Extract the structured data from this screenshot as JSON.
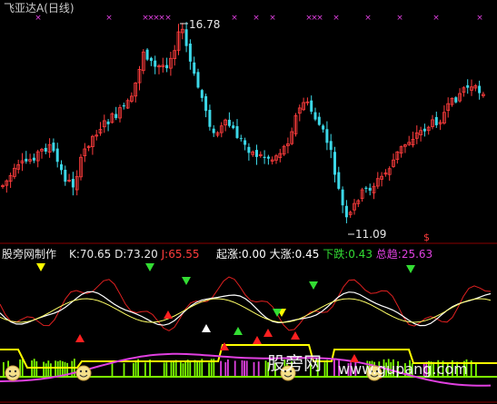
{
  "header": {
    "title": "飞亚达A",
    "period": "(日线)",
    "title_color": "#dddddd"
  },
  "price_panel": {
    "type": "candlestick",
    "high_label": "16.78",
    "low_label": "11.09",
    "high": 16.78,
    "low": 11.09,
    "dollar_mark": "$",
    "x_markers": "×"
  },
  "indicator_panel": {
    "name": "股旁网制作",
    "values": [
      {
        "label": "K:",
        "value": "70.65",
        "color": "#e8e8e8"
      },
      {
        "label": "D:",
        "value": "73.20",
        "color": "#e8e8e8"
      },
      {
        "label": "J:",
        "value": "65.55",
        "color": "#ff3c3c"
      },
      {
        "label": "起涨:",
        "value": "0.00",
        "color": "#ffffff"
      },
      {
        "label": "大涨:",
        "value": "0.45",
        "color": "#ffffff"
      },
      {
        "label": "下跌:",
        "value": "0.43",
        "color": "#33dd33"
      },
      {
        "label": "总趋:",
        "value": "25.63",
        "color": "#e040e0"
      }
    ],
    "watermark": "股旁网",
    "watermark_url": "www.gupang.com"
  },
  "chart_data": {
    "type": "candlestick",
    "ylim": [
      11.09,
      16.78
    ],
    "annotations": [
      "16.78",
      "11.09"
    ],
    "series": [
      {
        "name": "K",
        "value": 70.65
      },
      {
        "name": "D",
        "value": 73.2
      },
      {
        "name": "J",
        "value": 65.55
      },
      {
        "name": "起涨",
        "value": 0.0
      },
      {
        "name": "大涨",
        "value": 0.45
      },
      {
        "name": "下跌",
        "value": 0.43
      },
      {
        "name": "总趋",
        "value": 25.63
      }
    ]
  },
  "colors": {
    "up": "#ff3c3c",
    "down": "#3cd8e8",
    "k_line": "#ffffff",
    "d_line": "#ffff66",
    "j_line": "#e02020",
    "trend": "#e040e0",
    "bars_green": "#7cfc00",
    "bars_magenta": "#e040e0",
    "yellow_step": "#ffff00",
    "grid": "#7a0000"
  }
}
